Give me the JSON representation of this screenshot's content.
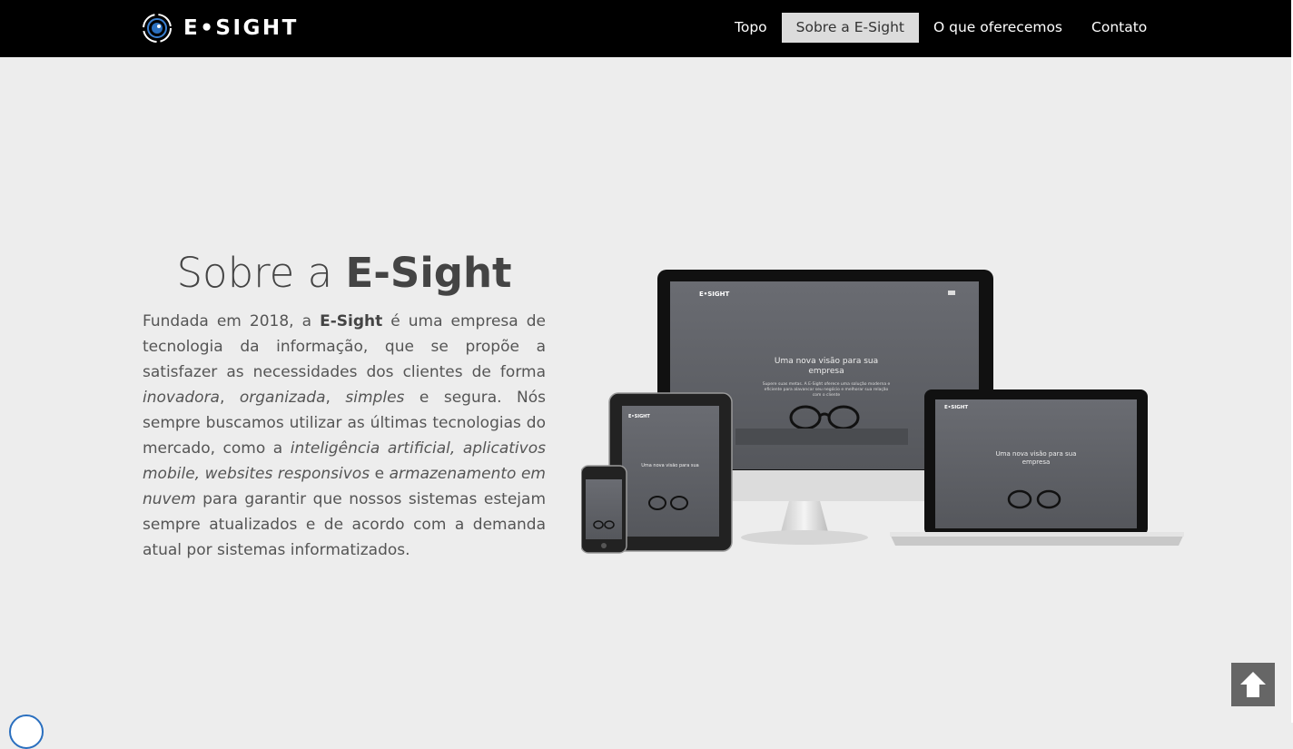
{
  "brand": {
    "name": "E•SIGHT",
    "logo_icon": "eye-target-logo-icon"
  },
  "nav": {
    "items": [
      {
        "label": "Topo",
        "active": false
      },
      {
        "label": "Sobre a E-Sight",
        "active": true
      },
      {
        "label": "O que oferecemos",
        "active": false
      },
      {
        "label": "Contato",
        "active": false
      }
    ]
  },
  "about": {
    "title_prefix": "Sobre a ",
    "title_brand": "E-Sight",
    "p1": "Fundada em 2018, a ",
    "p_brand": "E-Sight",
    "p2": " é uma empresa de tecnologia da informação, que se propõe a satisfazer as necessidades dos clientes de forma ",
    "i1": "inovadora",
    "s1": ", ",
    "i2": "organizada",
    "s2": ", ",
    "i3": "simples",
    "p3": " e segura. Nós sempre buscamos utilizar as últimas tecnologias do mercado, como a ",
    "i4": "inteligência artificial",
    "s3": ", ",
    "i5": "aplicativos mobile",
    "s4": ", ",
    "i6": "websites responsivos",
    "p4": " e ",
    "i7": "armazenamento em nuvem",
    "p5": " para garantir que nossos sistemas estejam sempre atualizados e de acordo com a demanda atual por sistemas informatizados."
  },
  "mockup": {
    "screen_brand": "E•SIGHT",
    "screen_headline_1": "Uma nova visão para sua",
    "screen_headline_2": "empresa",
    "screen_sub_1": "Supere suas metas. A E-Sight oferece uma solução moderna e",
    "screen_sub_2": "eficiente para alavancar seu negócio e melhorar sua relação",
    "screen_sub_3": "com o cliente",
    "screen_color": "#5f6166"
  },
  "back_to_top": {
    "icon": "arrow-up-icon"
  },
  "colors": {
    "topbar": "#000000",
    "background": "#ededed",
    "active_nav": "#dcdcdc",
    "button": "#666666"
  }
}
